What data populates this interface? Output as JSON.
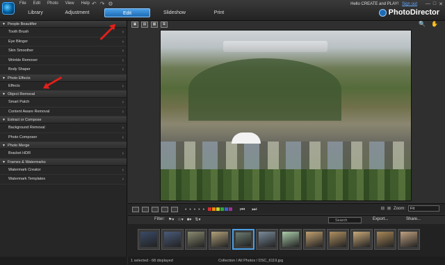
{
  "menu": [
    "File",
    "Edit",
    "Photo",
    "View",
    "Help"
  ],
  "modes": [
    "Library",
    "Adjustment",
    "Edit",
    "Slideshow",
    "Print"
  ],
  "active_mode": "Edit",
  "user": {
    "greeting": "Hello CREATE and PLAY!",
    "signout": "Sign out"
  },
  "brand": "PhotoDirector",
  "categories": [
    {
      "title": "People Beautifier",
      "items": [
        "Tooth Brush",
        "Eye Blinger",
        "Skin Smoother",
        "Wrinkle Remover",
        "Body Shaper"
      ]
    },
    {
      "title": "Photo Effects",
      "items": [
        "Effects"
      ]
    },
    {
      "title": "Object Removal",
      "items": [
        "Smart Patch",
        "Content Aware Removal"
      ]
    },
    {
      "title": "Extract or Compose",
      "items": [
        "Background Removal",
        "Photo Composer"
      ]
    },
    {
      "title": "Photo Merge",
      "items": [
        "Bracket HDR"
      ]
    },
    {
      "title": "Frames & Watermarks",
      "items": [
        "Watermark Creator",
        "Watermark Templates"
      ]
    }
  ],
  "toolbar": {
    "zoom_label": "Zoom:",
    "zoom_value": "Fit"
  },
  "filmstrip": {
    "filter_label": "Filter:",
    "search_placeholder": "Search",
    "export_label": "Export...",
    "share_label": "Share..."
  },
  "thumb_colors": [
    "#3a4a66",
    "#4a5a7a",
    "#8a8a70",
    "#b0a07a",
    "#6a7a70",
    "#7a8a9a",
    "#aaccaa",
    "#c0a070",
    "#b09060",
    "#c8a878",
    "#a88858",
    "#c0a080"
  ],
  "selected_thumb": 4,
  "status": {
    "selection": "1 selected - 68 displayed",
    "path": "Collection / All Photos / DSC_6119.jpg"
  },
  "accent": "#1d6cb5",
  "annotation_color": "#e0201a"
}
